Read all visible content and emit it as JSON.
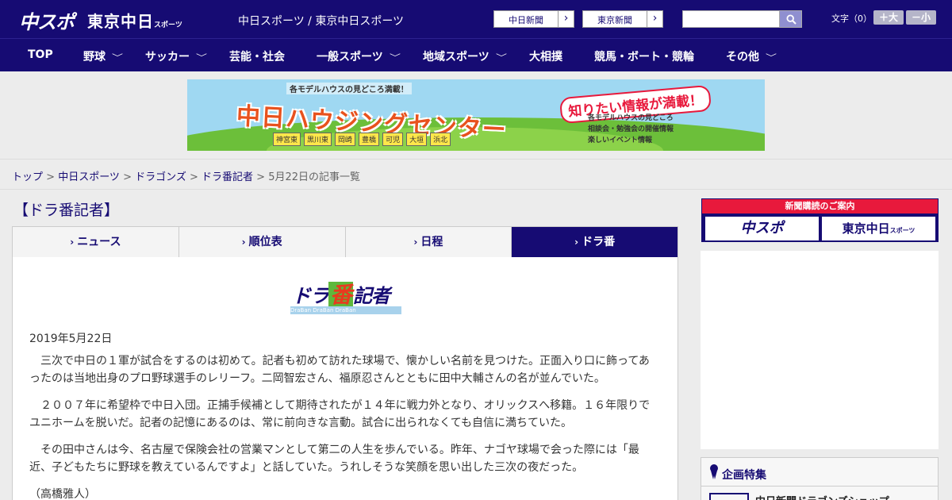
{
  "header": {
    "logo_primary": "中スポ",
    "logo_secondary": "東京中日",
    "logo_secondary_small": "スポーツ",
    "site_title": "中日スポーツ / 東京中日スポーツ",
    "paper_link_1": "中日新聞",
    "paper_link_2": "東京新聞",
    "arrow": "›",
    "search_placeholder": "",
    "font_label": "文字（0）",
    "font_larger": "＋大",
    "font_smaller": "－小"
  },
  "nav": {
    "items": [
      {
        "label": "TOP"
      },
      {
        "label": "野球"
      },
      {
        "label": "サッカー"
      },
      {
        "label": "芸能・社会"
      },
      {
        "label": "一般スポーツ"
      },
      {
        "label": "地域スポーツ"
      },
      {
        "label": "大相撲"
      },
      {
        "label": "競馬・ボート・競輪"
      },
      {
        "label": "その他"
      }
    ],
    "chevron": "﹀"
  },
  "banner": {
    "top_text": "各モデルハウスの見どころ満載！",
    "main_text": "中日ハウジングセンター",
    "towns": [
      "神宮東",
      "黒川東",
      "岡崎",
      "豊橋",
      "可児",
      "大垣",
      "浜北"
    ],
    "cta": "知りたい情報が満載！",
    "info_1": "各モデルハウスの見どころ",
    "info_2": "相談会・勉強会の開催情報",
    "info_3": "楽しいイベント情報"
  },
  "breadcrumb": {
    "links": [
      "トップ",
      "中日スポーツ",
      "ドラゴンズ",
      "ドラ番記者"
    ],
    "current": "5月22日の記事一覧",
    "sep": " > "
  },
  "page": {
    "title": "【ドラ番記者】",
    "tabs": [
      {
        "label": "ニュース"
      },
      {
        "label": "順位表"
      },
      {
        "label": "日程"
      },
      {
        "label": "ドラ番"
      }
    ],
    "tab_chevron": "›",
    "corner_logo_a": "ドラ",
    "corner_logo_b": "番",
    "corner_logo_c": "記者",
    "corner_logo_strip": "DraBan   DraBan   DraBan",
    "date": "2019年5月22日",
    "paragraphs": [
      "　三次で中日の１軍が試合をするのは初めて。記者も初めて訪れた球場で、懐かしい名前を見つけた。正面入り口に飾ってあったのは当地出身のプロ野球選手のレリーフ。二岡智宏さん、福原忍さんとともに田中大輔さんの名が並んでいた。",
      "　２００７年に希望枠で中日入団。正捕手候補として期待されたが１４年に戦力外となり、オリックスへ移籍。１６年限りでユニホームを脱いだ。記者の記憶にあるのは、常に前向きな言動。試合に出られなくても自信に満ちていた。",
      "　その田中さんは今、名古屋で保険会社の営業マンとして第二の人生を歩んでいる。昨年、ナゴヤ球場で会った際には「最近、子どもたちに野球を教えているんですよ」と話していた。うれしそうな笑顔を思い出した三次の夜だった。",
      "（高橋雅人）"
    ]
  },
  "sidebar": {
    "subscribe_title": "新聞購読のご案内",
    "subscribe_btn_1": "中スポ",
    "subscribe_btn_2": "東京中日",
    "subscribe_btn_2_small": "スポーツ",
    "feature_title": "企画特集",
    "feature_item": "中日新聞ドラゴンズショップ"
  },
  "colors": {
    "brand": "#160b73",
    "accent_red": "#e8193c"
  }
}
